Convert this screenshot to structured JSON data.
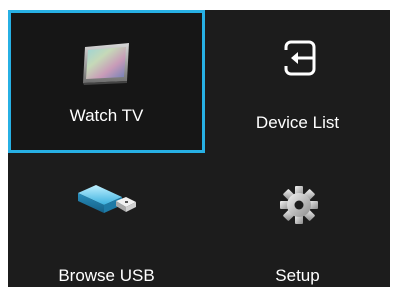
{
  "menu": {
    "items": [
      {
        "label": "Watch TV",
        "icon": "tv-icon",
        "selected": true
      },
      {
        "label": "Device List",
        "icon": "input-source-icon",
        "selected": false
      },
      {
        "label": "Browse USB",
        "icon": "usb-drive-icon",
        "selected": false
      },
      {
        "label": "Setup",
        "icon": "gear-icon",
        "selected": false
      }
    ]
  },
  "colors": {
    "background": "#1c1c1c",
    "selection_border": "#27b0e4",
    "text": "#ffffff"
  }
}
